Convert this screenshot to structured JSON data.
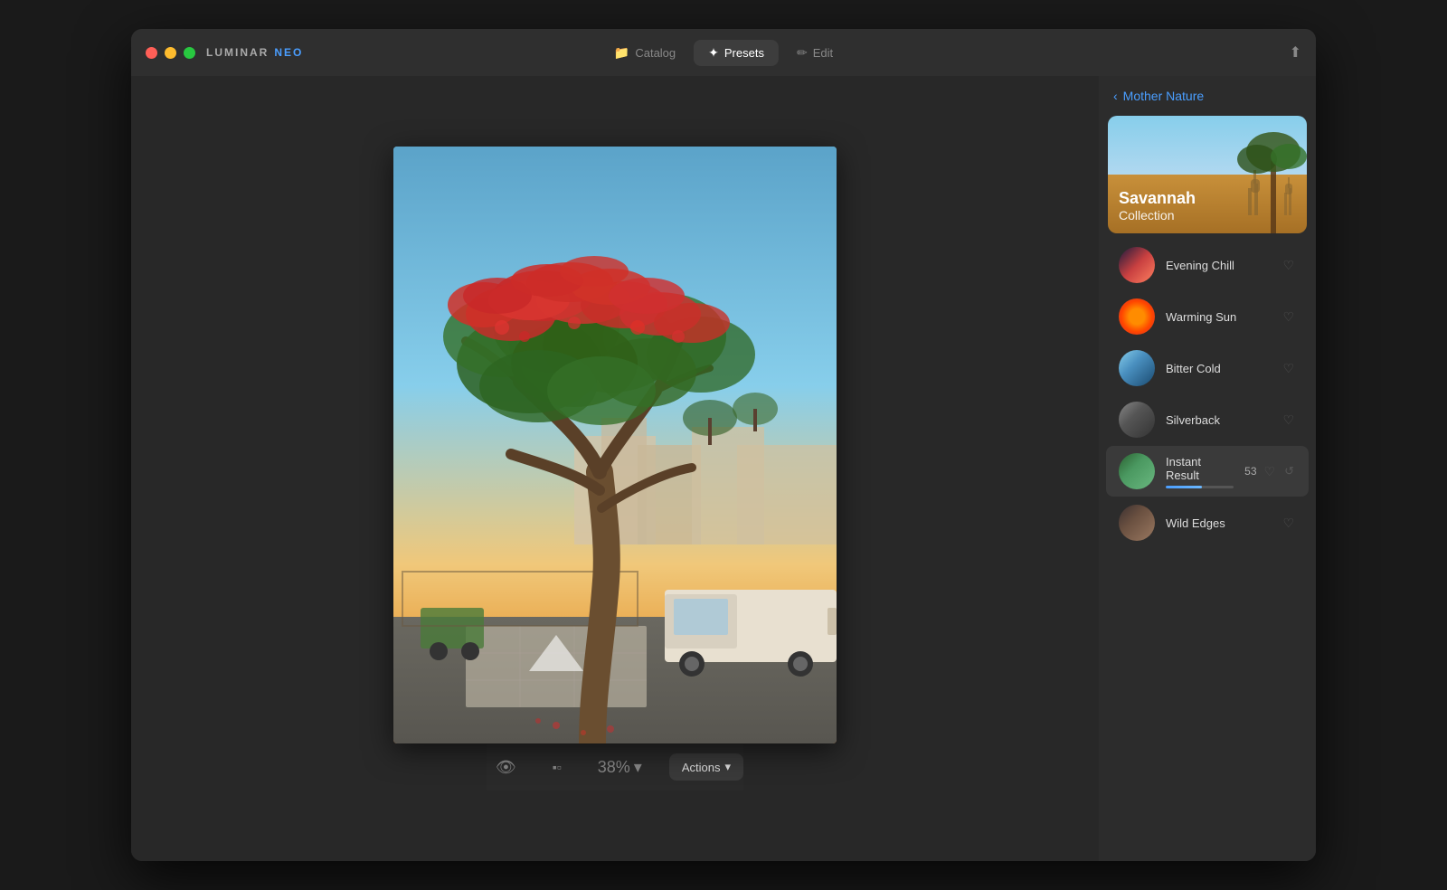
{
  "app": {
    "name": "LUMINAR",
    "neo": "NEO",
    "share_icon": "⬆"
  },
  "titlebar": {
    "tabs": [
      {
        "id": "catalog",
        "label": "Catalog",
        "icon": "📁",
        "active": false
      },
      {
        "id": "presets",
        "label": "Presets",
        "icon": "✦",
        "active": true
      },
      {
        "id": "edit",
        "label": "Edit",
        "icon": "✏",
        "active": false
      }
    ]
  },
  "toolbar": {
    "eye_icon": "👁",
    "split_left": "▪",
    "split_right": "▫",
    "zoom": "38%",
    "zoom_arrow": "▾",
    "actions_label": "Actions",
    "actions_arrow": "▾"
  },
  "sidebar": {
    "back_label": "Mother Nature",
    "hero": {
      "title_main": "Savannah",
      "title_sub": "Collection"
    },
    "presets": [
      {
        "id": "evening-chill",
        "name": "Evening Chill",
        "thumb_class": "thumb-evening",
        "active": false,
        "show_slider": false,
        "slider_pct": 0,
        "value": ""
      },
      {
        "id": "warming-sun",
        "name": "Warming Sun",
        "thumb_class": "thumb-warming",
        "active": false,
        "show_slider": false,
        "slider_pct": 0,
        "value": ""
      },
      {
        "id": "bitter-cold",
        "name": "Bitter Cold",
        "thumb_class": "thumb-bitter",
        "active": false,
        "show_slider": false,
        "slider_pct": 0,
        "value": ""
      },
      {
        "id": "silverback",
        "name": "Silverback",
        "thumb_class": "thumb-silverback",
        "active": false,
        "show_slider": false,
        "slider_pct": 0,
        "value": ""
      },
      {
        "id": "instant-result",
        "name": "Instant Result",
        "thumb_class": "thumb-instant",
        "active": true,
        "show_slider": true,
        "slider_pct": 53,
        "value": "53"
      },
      {
        "id": "wild-edges",
        "name": "Wild Edges",
        "thumb_class": "thumb-wild",
        "active": false,
        "show_slider": false,
        "slider_pct": 0,
        "value": ""
      }
    ]
  }
}
